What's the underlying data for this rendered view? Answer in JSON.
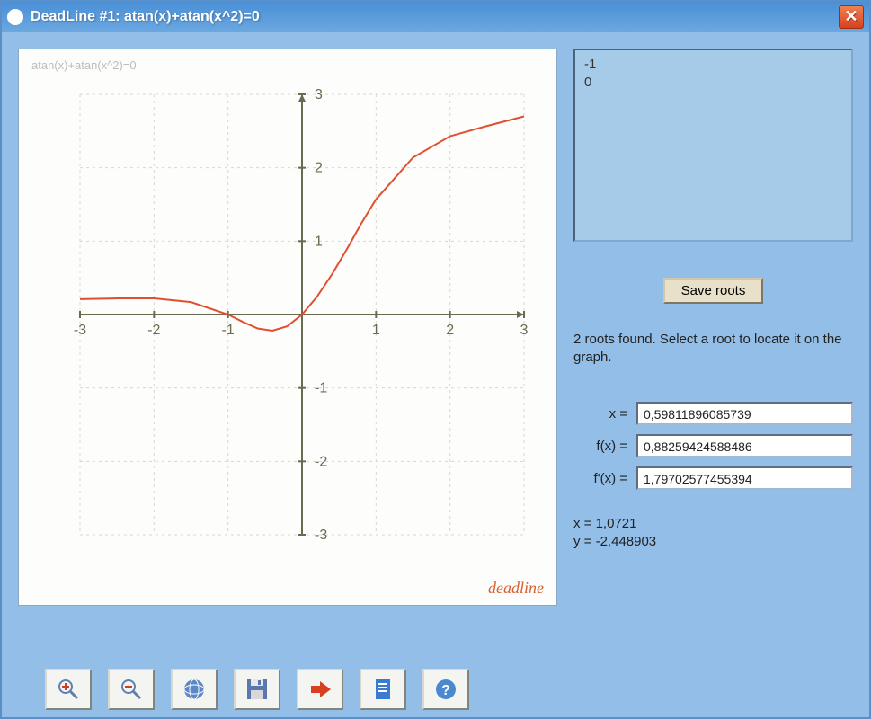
{
  "titlebar": {
    "title": "DeadLine #1: atan(x)+atan(x^2)=0"
  },
  "graph": {
    "caption": "atan(x)+atan(x^2)=0",
    "brand": "deadline"
  },
  "roots_panel": {
    "items": [
      "-1",
      "0"
    ]
  },
  "save_button_label": "Save roots",
  "hint_text": "2 roots found. Select a root to locate it on the graph.",
  "values": {
    "x_label": "x  =",
    "x_value": "0,59811896085739",
    "fx_label": "f(x) =",
    "fx_value": "0,88259424588486",
    "fpx_label": "f'(x) =",
    "fpx_value": "1,79702577455394"
  },
  "cursor": {
    "x_line": "x = 1,0721",
    "y_line": "y = -2,448903"
  },
  "toolbar": {
    "zoom_in": "zoom-in",
    "zoom_out": "zoom-out",
    "recenter": "recenter",
    "save_image": "save-image",
    "export": "export",
    "copy": "copy",
    "help": "help"
  },
  "chart_data": {
    "type": "line",
    "title": "atan(x)+atan(x^2)=0",
    "xlabel": "",
    "ylabel": "",
    "xlim": [
      -3,
      3
    ],
    "ylim": [
      -3,
      3
    ],
    "x_ticks": [
      -3,
      -2,
      -1,
      0,
      1,
      2,
      3
    ],
    "y_ticks": [
      -3,
      -2,
      -1,
      0,
      1,
      2,
      3
    ],
    "grid": true,
    "series": [
      {
        "name": "atan(x)+atan(x^2)",
        "color": "#e05030",
        "x": [
          -3.0,
          -2.5,
          -2.0,
          -1.5,
          -1.0,
          -0.8,
          -0.6,
          -0.4,
          -0.2,
          0.0,
          0.2,
          0.4,
          0.6,
          0.8,
          1.0,
          1.5,
          2.0,
          2.5,
          3.0
        ],
        "y": [
          0.21,
          0.22,
          0.22,
          0.17,
          0.0,
          -0.1,
          -0.19,
          -0.22,
          -0.16,
          0.0,
          0.24,
          0.54,
          0.88,
          1.24,
          1.57,
          2.14,
          2.43,
          2.57,
          2.7
        ]
      }
    ]
  }
}
